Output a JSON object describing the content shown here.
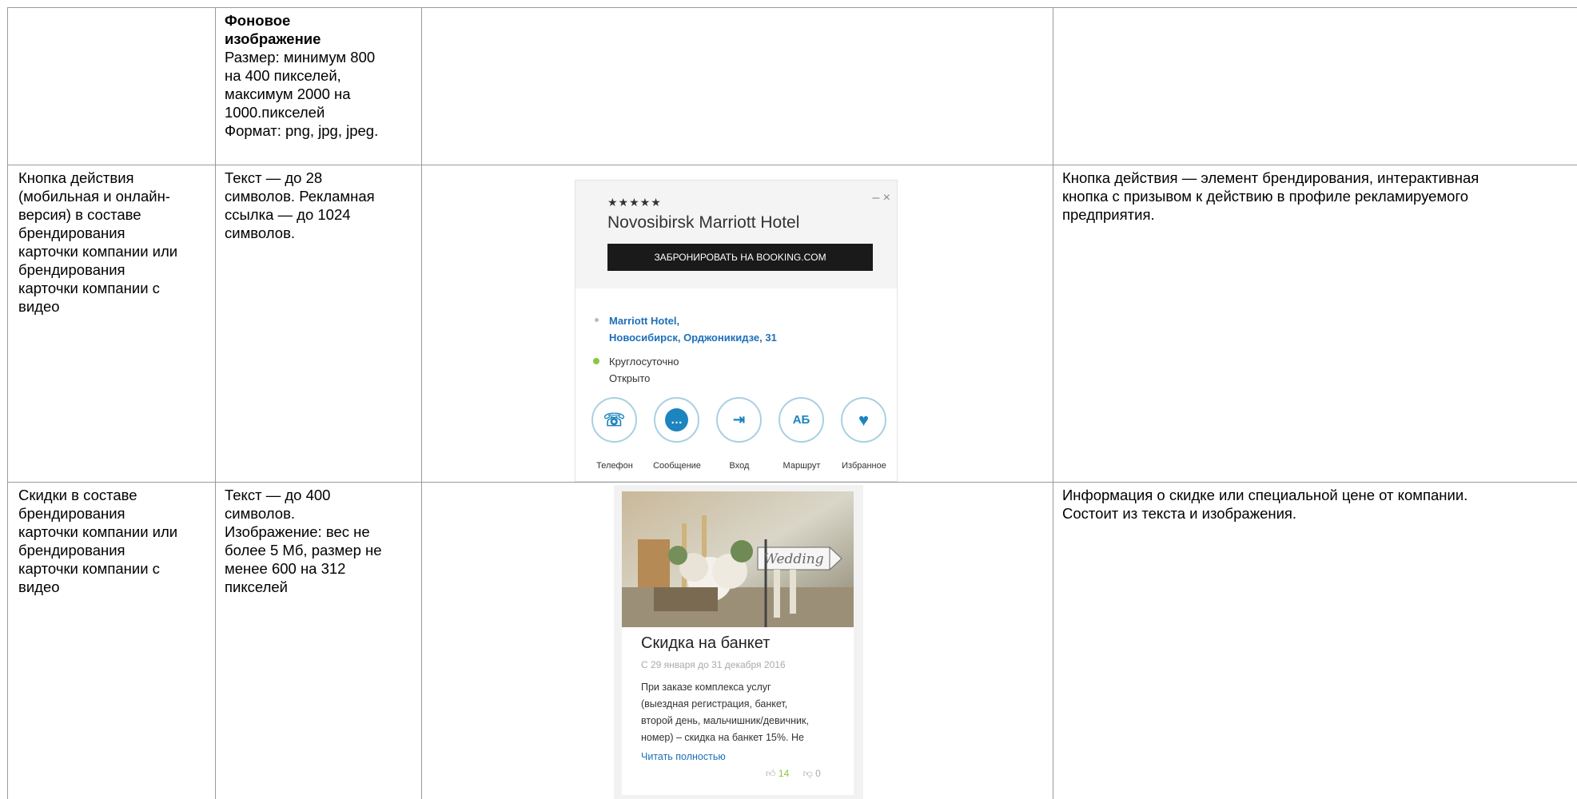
{
  "rows": [
    {
      "col1": "",
      "col2_bold": "Фоновое изображение",
      "col2_lines": [
        "Размер: минимум 800",
        "на 400 пикселей,",
        "максимум 2000 на",
        "1000.пикселей",
        "Формат: png, jpg, jpeg."
      ],
      "col4": ""
    },
    {
      "col1_lines": [
        "Кнопка действия",
        "(мобильная и онлайн-",
        "версия) в составе",
        "брендирования",
        "карточки компании или",
        "брендирования",
        "карточки компании с",
        "видео"
      ],
      "col2_lines": [
        "Текст — до 28",
        "символов. Рекламная",
        "ссылка — до 1024",
        "символов."
      ],
      "col4_lines": [
        "Кнопка действия — элемент брендирования, интерактивная",
        "кнопка с призывом к действию в профиле рекламируемого",
        "предприятия."
      ]
    },
    {
      "col1_lines": [
        "Скидки в составе",
        "брендирования",
        "карточки компании или",
        "брендирования",
        "карточки компании с",
        "видео"
      ],
      "col2_lines": [
        "Текст — до 400",
        "символов.",
        "Изображение: вес не",
        "более 5 Мб, размер не",
        "менее 600 на 312",
        "пикселей"
      ],
      "col4_lines": [
        "Информация о скидке или специальной цене от компании.",
        "Состоит из текста и изображения."
      ]
    }
  ],
  "booking_card": {
    "stars": "★★★★★",
    "window_controls": "– ×",
    "hotel_name": "Novosibirsk Marriott Hotel",
    "book_button": "ЗАБРОНИРОВАТЬ НА BOOKING.COM",
    "address_line1": "Marriott Hotel,",
    "address_line2": "Новосибирск, Орджоникидзе, 31",
    "hours": "Круглосуточно",
    "status": "Открыто",
    "actions": [
      {
        "label": "Телефон",
        "icon": "phone-icon"
      },
      {
        "label": "Сообщение",
        "icon": "message-icon"
      },
      {
        "label": "Вход",
        "icon": "entrance-icon"
      },
      {
        "label": "Маршрут",
        "icon": "route-icon"
      },
      {
        "label": "Избранное",
        "icon": "heart-icon"
      }
    ],
    "colors": {
      "accent": "#1c84be",
      "link": "#1e6fb8",
      "open": "#8cc63f"
    }
  },
  "discount_card": {
    "photo_text": "Wedding",
    "title": "Скидка на банкет",
    "dates": "С 29 января до 31 декабря 2016",
    "text_lines": [
      "При заказе комплекса услуг",
      "(выездная регистрация, банкет,",
      "второй день, мальчишник/девичник,",
      "номер) – скидка на банкет 15%. Не"
    ],
    "read_more": "Читать полностью",
    "likes": "14",
    "dislikes": "0"
  }
}
